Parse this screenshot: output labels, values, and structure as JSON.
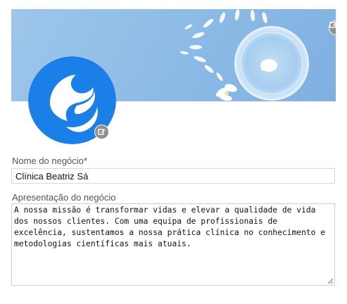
{
  "form": {
    "name_label": "Nome do negócio*",
    "name_value": "Clínica Beatriz Sá",
    "about_label": "Apresentação do negócio",
    "about_value": "A nossa missão é transformar vidas e elevar a qualidade de vida dos nossos clientes. Com uma equipa de profissionais de excelência, sustentamos a nossa prática clínica no conhecimento e metodologias científicas mais atuais."
  },
  "icons": {
    "cover_edit": "edit-icon",
    "avatar_edit": "edit-icon",
    "logo": "s-logo",
    "resize": "resize-grip-icon"
  },
  "colors": {
    "logo_blue": "#1a7fe6",
    "cover_blue": "#8cbae6",
    "edit_button": "#8f8f8f"
  }
}
